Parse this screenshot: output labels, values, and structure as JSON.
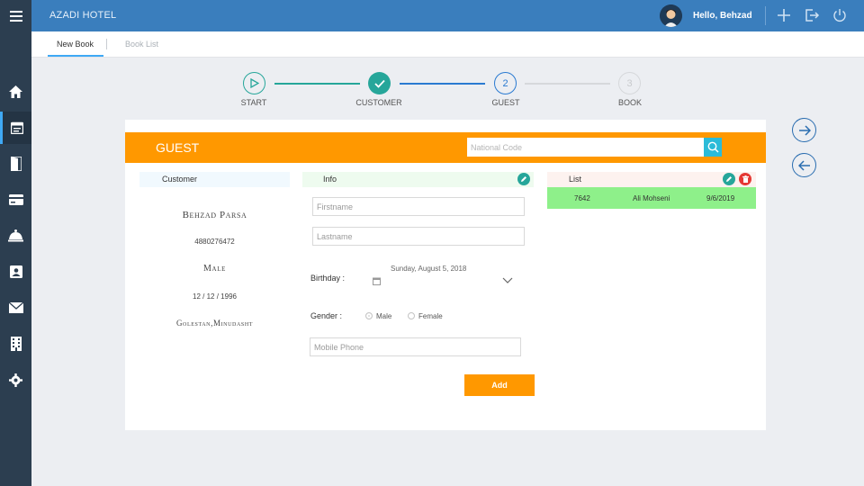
{
  "header": {
    "app_title": "AZADI HOTEL",
    "greeting": "Hello, Behzad",
    "icons": [
      "menu-icon",
      "user-avatar",
      "plus-icon",
      "logout-icon",
      "power-icon"
    ]
  },
  "sidebar": {
    "items": [
      {
        "icon": "home-icon"
      },
      {
        "icon": "calendar-icon",
        "active": true
      },
      {
        "icon": "door-icon"
      },
      {
        "icon": "credit-card-icon"
      },
      {
        "icon": "room-service-icon"
      },
      {
        "icon": "contact-card-icon"
      },
      {
        "icon": "mail-icon"
      },
      {
        "icon": "building-icon"
      },
      {
        "icon": "settings-icon"
      }
    ]
  },
  "tabs": [
    {
      "label": "New Book",
      "active": true
    },
    {
      "label": "Book List",
      "active": false
    }
  ],
  "stepper": {
    "steps": [
      {
        "label": "START",
        "state": "current-play"
      },
      {
        "label": "CUSTOMER",
        "state": "done"
      },
      {
        "label": "GUEST",
        "state": "active",
        "number": "2"
      },
      {
        "label": "BOOK",
        "state": "pending",
        "number": "3"
      }
    ]
  },
  "guest_panel": {
    "title": "GUEST",
    "national_code_placeholder": "National Code"
  },
  "customer": {
    "heading": "Customer",
    "name": "Behzad Parsa",
    "national_code": "4880276472",
    "gender": "Male",
    "birthdate": "12 / 12 / 1996",
    "location": "Golestan,Minudasht"
  },
  "info": {
    "heading": "Info",
    "firstname_placeholder": "Firstname",
    "lastname_placeholder": "Lastname",
    "birthday_label": "Birthday :",
    "birthday_value": "Sunday, August 5, 2018",
    "gender_label": "Gender :",
    "gender_options": [
      "Male",
      "Female"
    ],
    "gender_selected": "Male",
    "mobile_placeholder": "Mobile Phone",
    "add_label": "Add"
  },
  "list": {
    "heading": "List",
    "rows": [
      {
        "code": "7642",
        "name": "Ali Mohseni",
        "date": "9/6/2019"
      }
    ]
  },
  "colors": {
    "topbar": "#3a7ebd",
    "sidebar": "#2c3e50",
    "accent_orange": "#ff9800",
    "accent_teal": "#2bbbd8",
    "row_green": "#8ef08a",
    "done_green": "#26a69a",
    "active_blue": "#2a7ad1"
  }
}
